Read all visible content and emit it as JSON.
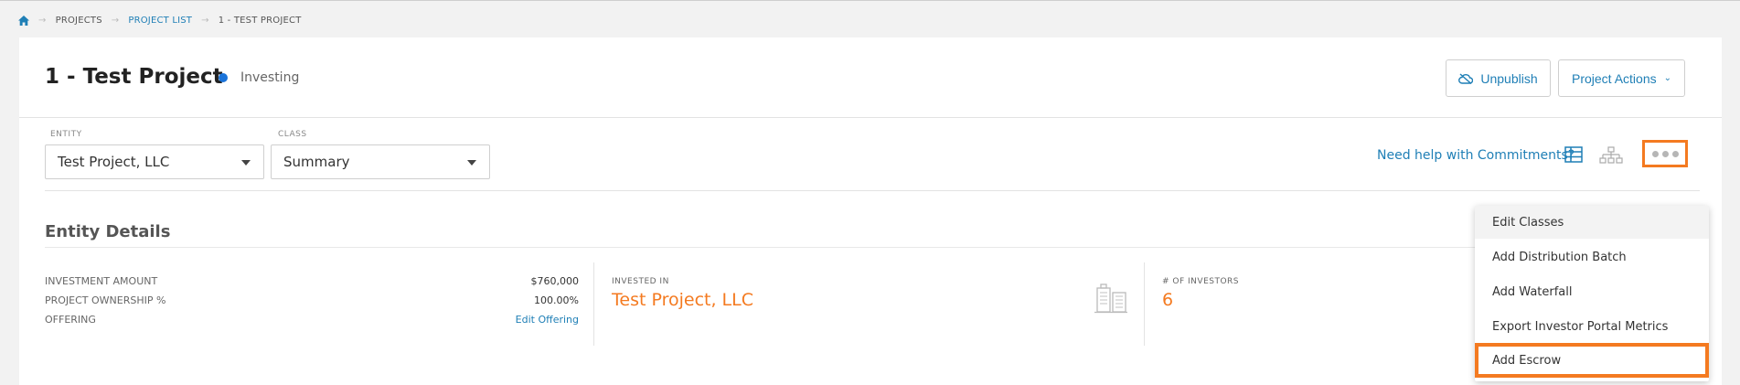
{
  "breadcrumb": {
    "items": [
      "PROJECTS",
      "PROJECT LIST",
      "1 - TEST PROJECT"
    ]
  },
  "header": {
    "title": "1 - Test Project",
    "status": "Investing",
    "status_color": "#1a73d9",
    "unpublish_label": "Unpublish",
    "actions_label": "Project Actions"
  },
  "filters": {
    "entity_label": "ENTITY",
    "entity_value": "Test Project, LLC",
    "class_label": "CLASS",
    "class_value": "Summary"
  },
  "toolbar": {
    "help_text": "Need help with Commitments?"
  },
  "menu": {
    "items": [
      "Edit Classes",
      "Add Distribution Batch",
      "Add Waterfall",
      "Export Investor Portal Metrics",
      "Add Escrow"
    ]
  },
  "entity_details": {
    "title": "Entity Details",
    "rows": [
      {
        "label": "INVESTMENT AMOUNT",
        "value": "$760,000"
      },
      {
        "label": "PROJECT OWNERSHIP %",
        "value": "100.00%"
      },
      {
        "label": "OFFERING",
        "value": "Edit Offering"
      }
    ],
    "invested_in_label": "INVESTED IN",
    "invested_in_value": "Test Project, LLC",
    "investors_label": "# OF INVESTORS",
    "investors_value": "6"
  },
  "colors": {
    "accent": "#1f7fb6",
    "highlight": "#f47a20"
  }
}
